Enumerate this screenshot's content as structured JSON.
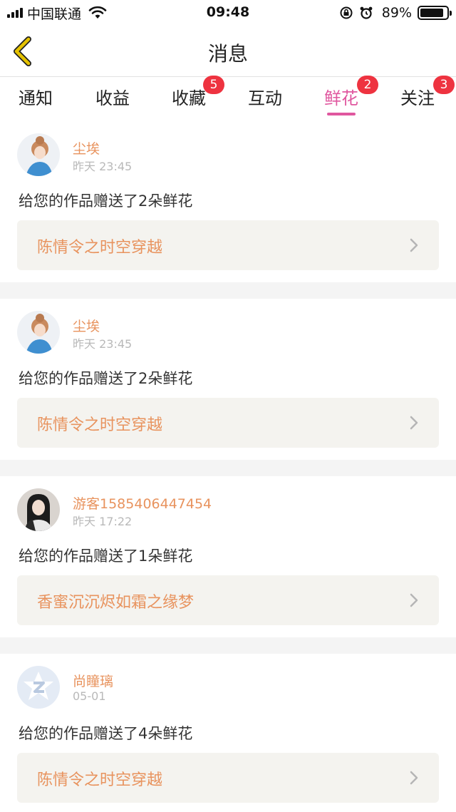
{
  "status_bar": {
    "carrier": "中国联通",
    "time": "09:48",
    "battery": "89%",
    "battery_level": 0.89
  },
  "header": {
    "title": "消息",
    "back_icon": "chevron-left-icon",
    "accent_color": "#e5c200"
  },
  "tabs": [
    {
      "label": "通知",
      "badge": ""
    },
    {
      "label": "收益",
      "badge": ""
    },
    {
      "label": "收藏",
      "badge": "5"
    },
    {
      "label": "互动",
      "badge": ""
    },
    {
      "label": "鲜花",
      "badge": "2",
      "active": true
    },
    {
      "label": "关注",
      "badge": "3"
    }
  ],
  "colors": {
    "active_tab": "#e0579f",
    "badge": "#ee3340",
    "username": "#e8935e",
    "work_title": "#e8935e",
    "work_bg": "#f4f3ef"
  },
  "messages": [
    {
      "user": "尘埃",
      "time": "昨天 23:45",
      "text": "给您的作品赠送了2朵鲜花",
      "work": "陈情令之时空穿越",
      "avatar": "girl-avatar-icon"
    },
    {
      "user": "尘埃",
      "time": "昨天 23:45",
      "text": "给您的作品赠送了2朵鲜花",
      "work": "陈情令之时空穿越",
      "avatar": "girl-avatar-icon"
    },
    {
      "user": "游客1585406447454",
      "time": "昨天 17:22",
      "text": "给您的作品赠送了1朵鲜花",
      "work": "香蜜沉沉烬如霜之缘梦",
      "avatar": "photo-avatar-icon"
    },
    {
      "user": "尚瞳璃",
      "time": "05-01",
      "text": "给您的作品赠送了4朵鲜花",
      "work": "陈情令之时空穿越",
      "avatar": "default-avatar-icon"
    }
  ]
}
